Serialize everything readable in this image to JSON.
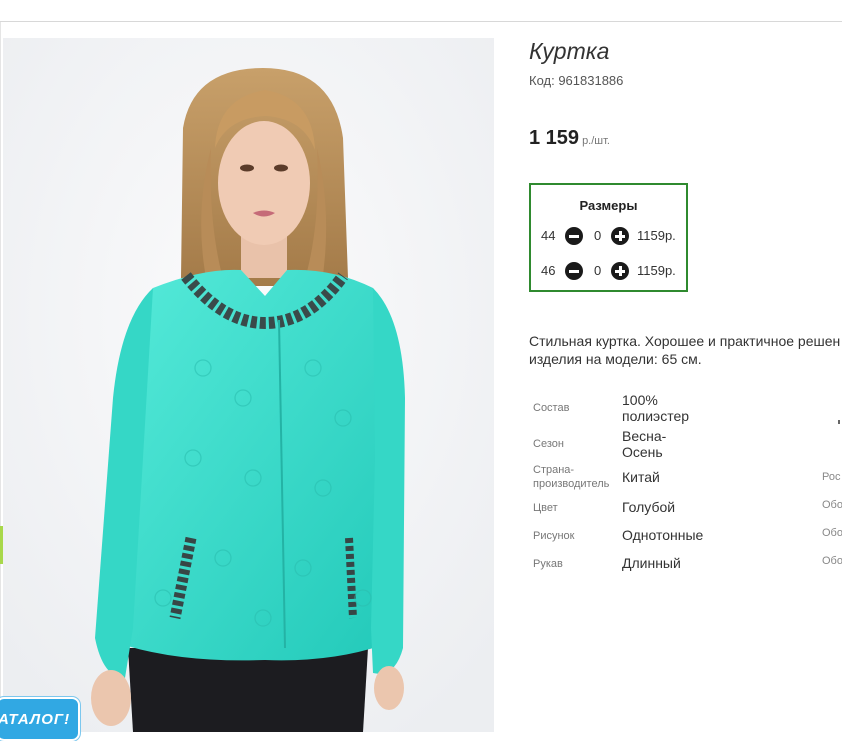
{
  "product": {
    "title": "Куртка",
    "code": "Код: 961831886",
    "price": "1 159",
    "price_unit": "р./шт.",
    "description_line1": "Стильная куртка. Хорошее и практичное решен",
    "description_line2": "изделия на модели: 65 см."
  },
  "sizes": {
    "title": "Размеры",
    "rows": [
      {
        "size": "44",
        "qty": "0",
        "price": "1159р."
      },
      {
        "size": "46",
        "qty": "0",
        "price": "1159р."
      }
    ]
  },
  "attributes": [
    {
      "key": "Состав",
      "value": "100% полиэстер",
      "right": ""
    },
    {
      "key": "Сезон",
      "value": "Весна-Осень",
      "right": ""
    },
    {
      "key": "Страна-производитель",
      "value": "Китай",
      "right": "Рос"
    },
    {
      "key": "Цвет",
      "value": "Голубой",
      "right": "Обо"
    },
    {
      "key": "Рисунок",
      "value": "Однотонные",
      "right": "Обо"
    },
    {
      "key": "Рукав",
      "value": "Длинный",
      "right": "Обо"
    }
  ],
  "catalog_badge": "АТАЛОГ!",
  "colors": {
    "jacket": "#3fe0d0",
    "sizes_border": "#2f8a2f",
    "badge": "#31a8e3"
  }
}
